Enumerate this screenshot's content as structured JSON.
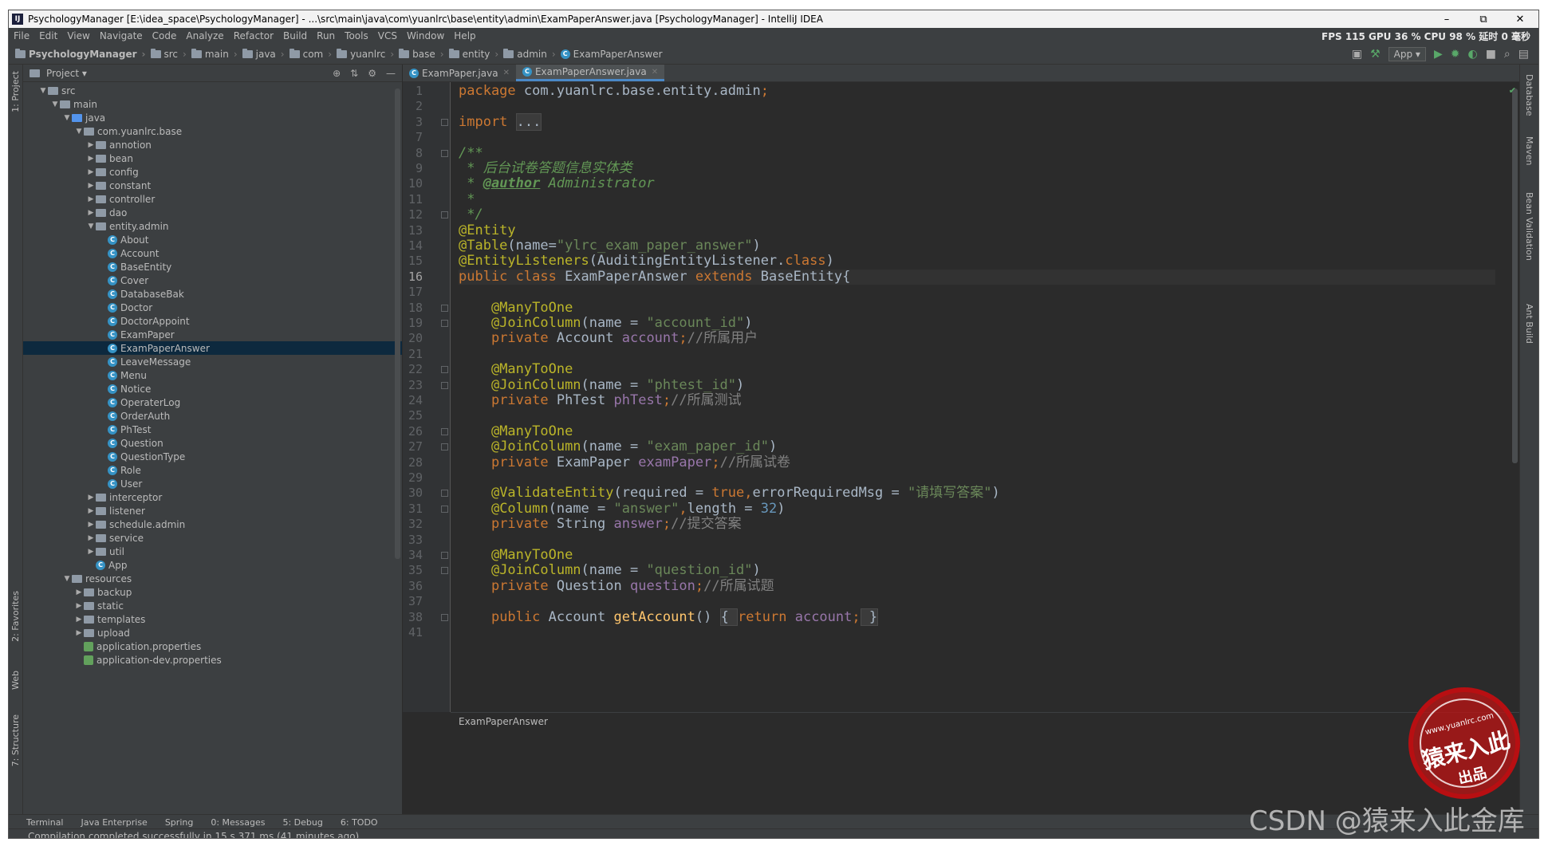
{
  "window": {
    "title": "PsychologyManager [E:\\idea_space\\PsychologyManager] - ...\\src\\main\\java\\com\\yuanlrc\\base\\entity\\admin\\ExamPaperAnswer.java [PsychologyManager] - IntelliJ IDEA",
    "app_icon": "IJ",
    "minimize": "–",
    "restore": "⧉",
    "close": "✕"
  },
  "menu": [
    "File",
    "Edit",
    "View",
    "Navigate",
    "Code",
    "Analyze",
    "Refactor",
    "Build",
    "Run",
    "Tools",
    "VCS",
    "Window",
    "Help"
  ],
  "perf": "FPS 115 GPU 36 % CPU 98 % 延时 0 毫秒",
  "breadcrumbs": [
    "PsychologyManager",
    "src",
    "main",
    "java",
    "com",
    "yuanlrc",
    "base",
    "entity",
    "admin",
    "ExamPaperAnswer"
  ],
  "toolbar": {
    "run_config": "App ▾"
  },
  "left_tabs": {
    "project": "1: Project",
    "favorites": "2: Favorites",
    "web": "Web",
    "structure": "7: Structure"
  },
  "right_tabs": {
    "database": "Database",
    "maven": "Maven",
    "bean_validation": "Bean Validation",
    "ant_build": "Ant Build"
  },
  "project_panel": {
    "title": "Project ▾"
  },
  "tree": [
    {
      "label": "src",
      "level": 1,
      "arrow": "▼",
      "icon": "folder"
    },
    {
      "label": "main",
      "level": 2,
      "arrow": "▼",
      "icon": "folder"
    },
    {
      "label": "java",
      "level": 3,
      "arrow": "▼",
      "icon": "source"
    },
    {
      "label": "com.yuanlrc.base",
      "level": 4,
      "arrow": "▼",
      "icon": "package"
    },
    {
      "label": "annotion",
      "level": 5,
      "arrow": "▶",
      "icon": "package"
    },
    {
      "label": "bean",
      "level": 5,
      "arrow": "▶",
      "icon": "package"
    },
    {
      "label": "config",
      "level": 5,
      "arrow": "▶",
      "icon": "package"
    },
    {
      "label": "constant",
      "level": 5,
      "arrow": "▶",
      "icon": "package"
    },
    {
      "label": "controller",
      "level": 5,
      "arrow": "▶",
      "icon": "package"
    },
    {
      "label": "dao",
      "level": 5,
      "arrow": "▶",
      "icon": "package"
    },
    {
      "label": "entity.admin",
      "level": 5,
      "arrow": "▼",
      "icon": "package"
    },
    {
      "label": "About",
      "level": 6,
      "arrow": "",
      "icon": "class"
    },
    {
      "label": "Account",
      "level": 6,
      "arrow": "",
      "icon": "class"
    },
    {
      "label": "BaseEntity",
      "level": 6,
      "arrow": "",
      "icon": "class"
    },
    {
      "label": "Cover",
      "level": 6,
      "arrow": "",
      "icon": "class"
    },
    {
      "label": "DatabaseBak",
      "level": 6,
      "arrow": "",
      "icon": "class"
    },
    {
      "label": "Doctor",
      "level": 6,
      "arrow": "",
      "icon": "class"
    },
    {
      "label": "DoctorAppoint",
      "level": 6,
      "arrow": "",
      "icon": "class"
    },
    {
      "label": "ExamPaper",
      "level": 6,
      "arrow": "",
      "icon": "class"
    },
    {
      "label": "ExamPaperAnswer",
      "level": 6,
      "arrow": "",
      "icon": "class",
      "selected": true
    },
    {
      "label": "LeaveMessage",
      "level": 6,
      "arrow": "",
      "icon": "class"
    },
    {
      "label": "Menu",
      "level": 6,
      "arrow": "",
      "icon": "class"
    },
    {
      "label": "Notice",
      "level": 6,
      "arrow": "",
      "icon": "class"
    },
    {
      "label": "OperaterLog",
      "level": 6,
      "arrow": "",
      "icon": "class"
    },
    {
      "label": "OrderAuth",
      "level": 6,
      "arrow": "",
      "icon": "class"
    },
    {
      "label": "PhTest",
      "level": 6,
      "arrow": "",
      "icon": "class"
    },
    {
      "label": "Question",
      "level": 6,
      "arrow": "",
      "icon": "class"
    },
    {
      "label": "QuestionType",
      "level": 6,
      "arrow": "",
      "icon": "class"
    },
    {
      "label": "Role",
      "level": 6,
      "arrow": "",
      "icon": "class"
    },
    {
      "label": "User",
      "level": 6,
      "arrow": "",
      "icon": "class"
    },
    {
      "label": "interceptor",
      "level": 5,
      "arrow": "▶",
      "icon": "package"
    },
    {
      "label": "listener",
      "level": 5,
      "arrow": "▶",
      "icon": "package"
    },
    {
      "label": "schedule.admin",
      "level": 5,
      "arrow": "▶",
      "icon": "package"
    },
    {
      "label": "service",
      "level": 5,
      "arrow": "▶",
      "icon": "package"
    },
    {
      "label": "util",
      "level": 5,
      "arrow": "▶",
      "icon": "package"
    },
    {
      "label": "App",
      "level": 5,
      "arrow": "",
      "icon": "class"
    },
    {
      "label": "resources",
      "level": 3,
      "arrow": "▼",
      "icon": "resources"
    },
    {
      "label": "backup",
      "level": 4,
      "arrow": "▶",
      "icon": "folder"
    },
    {
      "label": "static",
      "level": 4,
      "arrow": "▶",
      "icon": "folder"
    },
    {
      "label": "templates",
      "level": 4,
      "arrow": "▶",
      "icon": "folder"
    },
    {
      "label": "upload",
      "level": 4,
      "arrow": "▶",
      "icon": "folder"
    },
    {
      "label": "application.properties",
      "level": 4,
      "arrow": "",
      "icon": "properties"
    },
    {
      "label": "application-dev.properties",
      "level": 4,
      "arrow": "",
      "icon": "properties"
    }
  ],
  "editor_tabs": [
    {
      "label": "ExamPaper.java",
      "active": false
    },
    {
      "label": "ExamPaperAnswer.java",
      "active": true
    }
  ],
  "current_line": 16,
  "code_lines": [
    {
      "n": 1,
      "tokens": [
        [
          "kw",
          "package "
        ],
        [
          "",
          "com.yuanlrc.base.entity.admin"
        ],
        [
          "kw",
          ";"
        ]
      ]
    },
    {
      "n": 2,
      "tokens": []
    },
    {
      "n": 3,
      "tokens": [
        [
          "kw",
          "import "
        ],
        [
          "fld",
          "..."
        ]
      ]
    },
    {
      "n": 7,
      "tokens": []
    },
    {
      "n": 8,
      "tokens": [
        [
          "dc",
          "/**"
        ]
      ]
    },
    {
      "n": 9,
      "tokens": [
        [
          "dc",
          " * 后台试卷答题信息实体类"
        ]
      ]
    },
    {
      "n": 10,
      "tokens": [
        [
          "dc",
          " * "
        ],
        [
          "tag",
          "@author"
        ],
        [
          "dc",
          " Administrator"
        ]
      ]
    },
    {
      "n": 11,
      "tokens": [
        [
          "dc",
          " *"
        ]
      ]
    },
    {
      "n": 12,
      "tokens": [
        [
          "dc",
          " */"
        ]
      ]
    },
    {
      "n": 13,
      "tokens": [
        [
          "an",
          "@Entity"
        ]
      ]
    },
    {
      "n": 14,
      "tokens": [
        [
          "an",
          "@Table"
        ],
        [
          "",
          "(name="
        ],
        [
          "st",
          "\"ylrc_exam_paper_answer\""
        ],
        [
          "",
          ")"
        ]
      ]
    },
    {
      "n": 15,
      "tokens": [
        [
          "an",
          "@EntityListeners"
        ],
        [
          "",
          "(AuditingEntityListener."
        ],
        [
          "kw",
          "class"
        ],
        [
          "",
          ")"
        ]
      ]
    },
    {
      "n": 16,
      "tokens": [
        [
          "kw",
          "public class "
        ],
        [
          "",
          "ExamPaperAnswer "
        ],
        [
          "kw",
          "extends "
        ],
        [
          "",
          "BaseEntity{"
        ]
      ]
    },
    {
      "n": 17,
      "tokens": []
    },
    {
      "n": 18,
      "tokens": [
        [
          "",
          "    "
        ],
        [
          "an",
          "@ManyToOne"
        ]
      ]
    },
    {
      "n": 19,
      "tokens": [
        [
          "",
          "    "
        ],
        [
          "an",
          "@JoinColumn"
        ],
        [
          "",
          "(name = "
        ],
        [
          "st",
          "\"account_id\""
        ],
        [
          "",
          ")"
        ]
      ]
    },
    {
      "n": 20,
      "tokens": [
        [
          "",
          "    "
        ],
        [
          "kw",
          "private "
        ],
        [
          "",
          "Account "
        ],
        [
          "fd",
          "account"
        ],
        [
          "kw",
          ";"
        ],
        [
          "cm",
          "//所属用户"
        ]
      ]
    },
    {
      "n": 21,
      "tokens": []
    },
    {
      "n": 22,
      "tokens": [
        [
          "",
          "    "
        ],
        [
          "an",
          "@ManyToOne"
        ]
      ]
    },
    {
      "n": 23,
      "tokens": [
        [
          "",
          "    "
        ],
        [
          "an",
          "@JoinColumn"
        ],
        [
          "",
          "(name = "
        ],
        [
          "st",
          "\"phtest_id\""
        ],
        [
          "",
          ")"
        ]
      ]
    },
    {
      "n": 24,
      "tokens": [
        [
          "",
          "    "
        ],
        [
          "kw",
          "private "
        ],
        [
          "",
          "PhTest "
        ],
        [
          "fd",
          "phTest"
        ],
        [
          "kw",
          ";"
        ],
        [
          "cm",
          "//所属测试"
        ]
      ]
    },
    {
      "n": 25,
      "tokens": []
    },
    {
      "n": 26,
      "tokens": [
        [
          "",
          "    "
        ],
        [
          "an",
          "@ManyToOne"
        ]
      ]
    },
    {
      "n": 27,
      "tokens": [
        [
          "",
          "    "
        ],
        [
          "an",
          "@JoinColumn"
        ],
        [
          "",
          "(name = "
        ],
        [
          "st",
          "\"exam_paper_id\""
        ],
        [
          "",
          ")"
        ]
      ]
    },
    {
      "n": 28,
      "tokens": [
        [
          "",
          "    "
        ],
        [
          "kw",
          "private "
        ],
        [
          "",
          "ExamPaper "
        ],
        [
          "fd",
          "examPaper"
        ],
        [
          "kw",
          ";"
        ],
        [
          "cm",
          "//所属试卷"
        ]
      ]
    },
    {
      "n": 29,
      "tokens": []
    },
    {
      "n": 30,
      "tokens": [
        [
          "",
          "    "
        ],
        [
          "an",
          "@ValidateEntity"
        ],
        [
          "",
          "(required = "
        ],
        [
          "kw",
          "true"
        ],
        [
          "kw",
          ","
        ],
        [
          "",
          "errorRequiredMsg = "
        ],
        [
          "st",
          "\"请填写答案\""
        ],
        [
          "",
          ")"
        ]
      ]
    },
    {
      "n": 31,
      "tokens": [
        [
          "",
          "    "
        ],
        [
          "an",
          "@Column"
        ],
        [
          "",
          "(name = "
        ],
        [
          "st",
          "\"answer\""
        ],
        [
          "kw",
          ","
        ],
        [
          "",
          "length = "
        ],
        [
          "nm",
          "32"
        ],
        [
          "",
          ")"
        ]
      ]
    },
    {
      "n": 32,
      "tokens": [
        [
          "",
          "    "
        ],
        [
          "kw",
          "private "
        ],
        [
          "",
          "String "
        ],
        [
          "fd",
          "answer"
        ],
        [
          "kw",
          ";"
        ],
        [
          "cm",
          "//提交答案"
        ]
      ]
    },
    {
      "n": 33,
      "tokens": []
    },
    {
      "n": 34,
      "tokens": [
        [
          "",
          "    "
        ],
        [
          "an",
          "@ManyToOne"
        ]
      ]
    },
    {
      "n": 35,
      "tokens": [
        [
          "",
          "    "
        ],
        [
          "an",
          "@JoinColumn"
        ],
        [
          "",
          "(name = "
        ],
        [
          "st",
          "\"question_id\""
        ],
        [
          "",
          ")"
        ]
      ]
    },
    {
      "n": 36,
      "tokens": [
        [
          "",
          "    "
        ],
        [
          "kw",
          "private "
        ],
        [
          "",
          "Question "
        ],
        [
          "fd",
          "question"
        ],
        [
          "kw",
          ";"
        ],
        [
          "cm",
          "//所属试题"
        ]
      ]
    },
    {
      "n": 37,
      "tokens": []
    },
    {
      "n": 38,
      "tokens": [
        [
          "",
          "    "
        ],
        [
          "kw",
          "public "
        ],
        [
          "",
          "Account "
        ],
        [
          "mt",
          "getAccount"
        ],
        [
          "",
          "() "
        ],
        [
          "fld",
          "{ "
        ],
        [
          "kw",
          "return "
        ],
        [
          "fd",
          "account"
        ],
        [
          "kw",
          ";"
        ],
        [
          "fld",
          " }"
        ]
      ]
    },
    {
      "n": 41,
      "tokens": []
    }
  ],
  "editor_footer": "ExamPaperAnswer",
  "bottom_tools": [
    "Terminal",
    "Java Enterprise",
    "Spring",
    "0: Messages",
    "5: Debug",
    "6: TODO"
  ],
  "status": "Compilation completed successfully in 15 s 371 ms (41 minutes ago)",
  "watermark": {
    "stamp_url": "www.yuanlrc.com",
    "stamp_main": "猿来入此",
    "stamp_sub": "出品",
    "csdn": "CSDN @猿来入此金库"
  }
}
